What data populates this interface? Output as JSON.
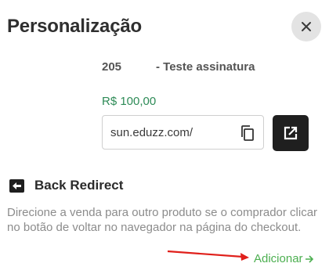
{
  "header": {
    "title": "Personalização",
    "close_icon": "close-icon"
  },
  "product": {
    "code": "205",
    "name": "- Teste assinatura",
    "price": "R$ 100,00",
    "url": "sun.eduzz.com/",
    "copy_icon": "copy-icon",
    "open_icon": "external-link-icon"
  },
  "back_redirect": {
    "icon": "back-arrow-box-icon",
    "title": "Back Redirect",
    "description": "Direcione a venda para outro produto se o comprador clicar no botão de voltar no navegador na página do checkout.",
    "add_label": "Adicionar",
    "add_icon": "arrow-right-icon"
  },
  "colors": {
    "price": "#2e8b57",
    "add_link": "#4caf50",
    "annotation_arrow": "#e0201b",
    "dark_button": "#1f1f1f"
  }
}
